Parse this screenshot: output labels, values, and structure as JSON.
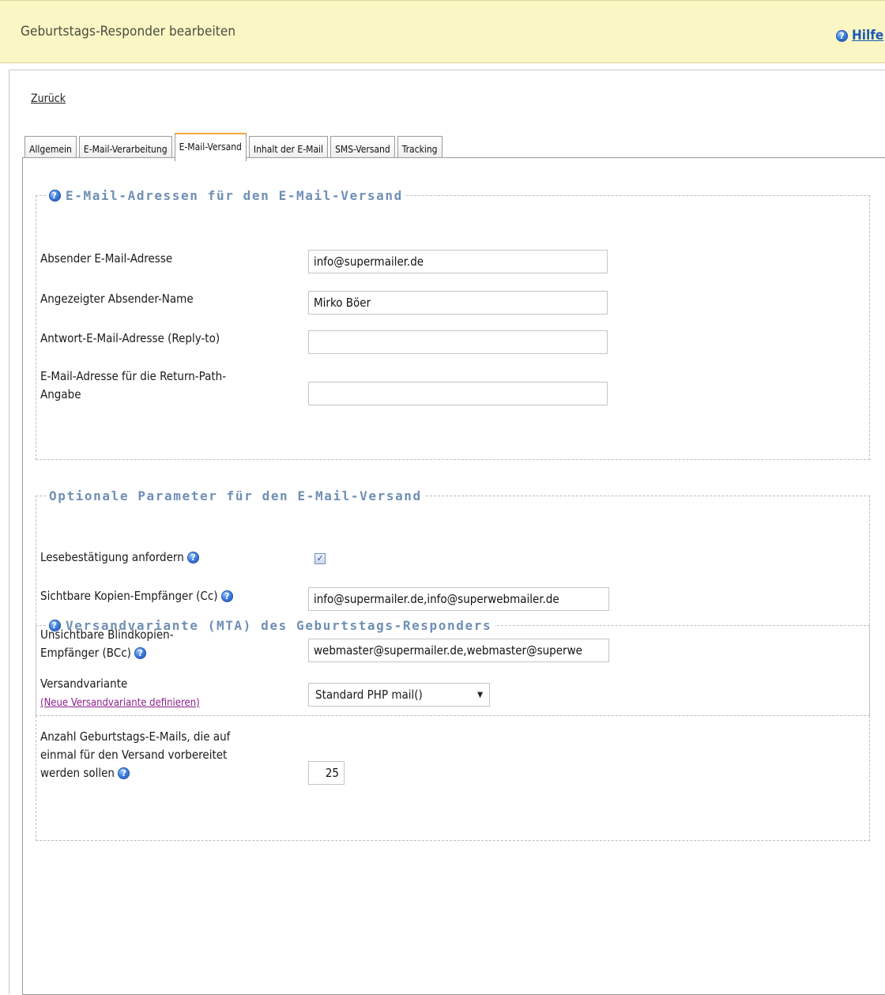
{
  "header": {
    "title": "Geburtstags-Responder bearbeiten",
    "help_label": "Hilfe"
  },
  "nav": {
    "back_label": "Zurück"
  },
  "tabs": [
    {
      "label": "Allgemein"
    },
    {
      "label": "E-Mail-Verarbeitung"
    },
    {
      "label": "E-Mail-Versand"
    },
    {
      "label": "Inhalt der E-Mail"
    },
    {
      "label": "SMS-Versand"
    },
    {
      "label": "Tracking"
    }
  ],
  "active_tab": "E-Mail-Versand",
  "sections": {
    "addresses": {
      "legend": "E-Mail-Adressen für den E-Mail-Versand",
      "sender_email_label": "Absender E-Mail-Adresse",
      "sender_email_value": "info@supermailer.de",
      "sender_name_label": "Angezeigter Absender-Name",
      "sender_name_value": "Mirko Böer",
      "reply_to_label": "Antwort-E-Mail-Adresse (Reply-to)",
      "reply_to_value": "",
      "return_path_label_1": "E-Mail-Adresse für die Return-Path-",
      "return_path_label_2": "Angabe",
      "return_path_value": ""
    },
    "optional": {
      "legend": "Optionale Parameter für den E-Mail-Versand",
      "read_receipt_label": "Lesebestätigung anfordern",
      "read_receipt_checked": true,
      "cc_label": "Sichtbare Kopien-Empfänger (Cc)",
      "cc_value": "info@supermailer.de,info@superwebmailer.de",
      "bcc_label_1": "Unsichtbare Blindkopien-",
      "bcc_label_2": "Empfänger (BCc)",
      "bcc_value": "webmaster@supermailer.de,webmaster@superwe"
    },
    "mta": {
      "legend": "Versandvariante (MTA) des Geburtstags-Responders",
      "variant_label": "Versandvariante",
      "new_variant_link": "(Neue Versandvariante definieren)",
      "variant_value": "Standard PHP mail()",
      "count_label_1": "Anzahl Geburtstags-E-Mails, die auf",
      "count_label_2": "einmal für den Versand vorbereitet",
      "count_label_3": "werden sollen",
      "count_value": "25"
    }
  },
  "colors": {
    "header_bg": "#fbf7c4",
    "legend": "#6f8fb5",
    "active_tab_accent": "#f2a93b",
    "link_purple": "#8a1f8a"
  }
}
